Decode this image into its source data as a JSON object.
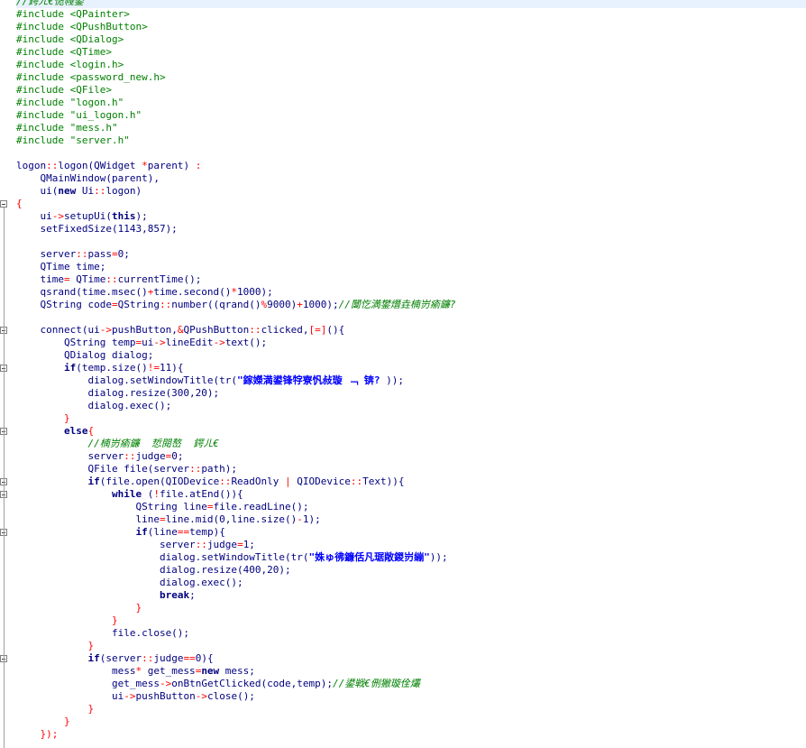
{
  "editor": {
    "lines": [
      [
        {
          "t": "//",
          "c": "cm"
        },
        {
          "t": "鍔ㄦ€佹帴鍙",
          "c": "cm"
        }
      ],
      [
        {
          "t": "#include <QPainter>",
          "c": "pp"
        }
      ],
      [
        {
          "t": "#include <QPushButton>",
          "c": "pp"
        }
      ],
      [
        {
          "t": "#include <QDialog>",
          "c": "pp"
        }
      ],
      [
        {
          "t": "#include <QTime>",
          "c": "pp"
        }
      ],
      [
        {
          "t": "#include <login.h>",
          "c": "pp"
        }
      ],
      [
        {
          "t": "#include <password_new.h>",
          "c": "pp"
        }
      ],
      [
        {
          "t": "#include <QFile>",
          "c": "pp"
        }
      ],
      [
        {
          "t": "#include \"logon.h\"",
          "c": "pp"
        }
      ],
      [
        {
          "t": "#include \"ui_logon.h\"",
          "c": "pp"
        }
      ],
      [
        {
          "t": "#include \"mess.h\"",
          "c": "pp"
        }
      ],
      [
        {
          "t": "#include \"server.h\"",
          "c": "pp"
        }
      ],
      [
        {
          "t": "",
          "c": "nm"
        }
      ],
      [
        {
          "t": "logon",
          "c": "nm"
        },
        {
          "t": "::",
          "c": "op"
        },
        {
          "t": "logon(QWidget ",
          "c": "nm"
        },
        {
          "t": "*",
          "c": "op"
        },
        {
          "t": "parent) ",
          "c": "nm"
        },
        {
          "t": ":",
          "c": "op"
        }
      ],
      [
        {
          "t": "    QMainWindow(parent),",
          "c": "nm"
        }
      ],
      [
        {
          "t": "    ui(",
          "c": "nm"
        },
        {
          "t": "new",
          "c": "kw"
        },
        {
          "t": " Ui",
          "c": "nm"
        },
        {
          "t": "::",
          "c": "op"
        },
        {
          "t": "logon)",
          "c": "nm"
        }
      ],
      [
        {
          "t": "{",
          "c": "op"
        }
      ],
      [
        {
          "t": "    ui",
          "c": "nm"
        },
        {
          "t": "->",
          "c": "op"
        },
        {
          "t": "setupUi(",
          "c": "nm"
        },
        {
          "t": "this",
          "c": "kw"
        },
        {
          "t": ");",
          "c": "nm"
        }
      ],
      [
        {
          "t": "    setFixedSize(1143,857);",
          "c": "nm"
        }
      ],
      [
        {
          "t": "",
          "c": "nm"
        }
      ],
      [
        {
          "t": "    server",
          "c": "nm"
        },
        {
          "t": "::",
          "c": "op"
        },
        {
          "t": "pass",
          "c": "nm"
        },
        {
          "t": "=",
          "c": "op"
        },
        {
          "t": "0;",
          "c": "nm"
        }
      ],
      [
        {
          "t": "    QTime time;",
          "c": "nm"
        }
      ],
      [
        {
          "t": "    time",
          "c": "nm"
        },
        {
          "t": "=",
          "c": "op"
        },
        {
          "t": " QTime",
          "c": "nm"
        },
        {
          "t": "::",
          "c": "op"
        },
        {
          "t": "currentTime();",
          "c": "nm"
        }
      ],
      [
        {
          "t": "    qsrand(time.msec()",
          "c": "nm"
        },
        {
          "t": "+",
          "c": "op"
        },
        {
          "t": "time.second()",
          "c": "nm"
        },
        {
          "t": "*",
          "c": "op"
        },
        {
          "t": "1000);",
          "c": "nm"
        }
      ],
      [
        {
          "t": "    QString code",
          "c": "nm"
        },
        {
          "t": "=",
          "c": "op"
        },
        {
          "t": "QString",
          "c": "nm"
        },
        {
          "t": "::",
          "c": "op"
        },
        {
          "t": "number((qrand()",
          "c": "nm"
        },
        {
          "t": "%",
          "c": "op"
        },
        {
          "t": "9000)",
          "c": "nm"
        },
        {
          "t": "+",
          "c": "op"
        },
        {
          "t": "1000);",
          "c": "nm"
        },
        {
          "t": "//闅忔満鐢熸垚楠岃瘉鐮?",
          "c": "cm"
        }
      ],
      [
        {
          "t": "",
          "c": "nm"
        }
      ],
      [
        {
          "t": "    connect(ui",
          "c": "nm"
        },
        {
          "t": "->",
          "c": "op"
        },
        {
          "t": "pushButton,",
          "c": "nm"
        },
        {
          "t": "&",
          "c": "op"
        },
        {
          "t": "QPushButton",
          "c": "nm"
        },
        {
          "t": "::",
          "c": "op"
        },
        {
          "t": "clicked,",
          "c": "nm"
        },
        {
          "t": "[=]",
          "c": "op"
        },
        {
          "t": "(){",
          "c": "nm"
        }
      ],
      [
        {
          "t": "        QString temp",
          "c": "nm"
        },
        {
          "t": "=",
          "c": "op"
        },
        {
          "t": "ui",
          "c": "nm"
        },
        {
          "t": "->",
          "c": "op"
        },
        {
          "t": "lineEdit",
          "c": "nm"
        },
        {
          "t": "->",
          "c": "op"
        },
        {
          "t": "text();",
          "c": "nm"
        }
      ],
      [
        {
          "t": "        QDialog dialog;",
          "c": "nm"
        }
      ],
      [
        {
          "t": "        ",
          "c": "nm"
        },
        {
          "t": "if",
          "c": "kw"
        },
        {
          "t": "(temp.size()",
          "c": "nm"
        },
        {
          "t": "!=",
          "c": "op"
        },
        {
          "t": "11){",
          "c": "nm"
        }
      ],
      [
        {
          "t": "            dialog.setWindowTitle(tr(",
          "c": "nm"
        },
        {
          "t": "\"鎵嬫満鍙锋牸寮忛敊璇 ﹁ 锛? ",
          "c": "qstr"
        },
        {
          "t": "));",
          "c": "nm"
        }
      ],
      [
        {
          "t": "            dialog.resize(300,20);",
          "c": "nm"
        }
      ],
      [
        {
          "t": "            dialog.exec();",
          "c": "nm"
        }
      ],
      [
        {
          "t": "        }",
          "c": "op"
        }
      ],
      [
        {
          "t": "        ",
          "c": "nm"
        },
        {
          "t": "else",
          "c": "kw"
        },
        {
          "t": "{",
          "c": "op"
        }
      ],
      [
        {
          "t": "            ",
          "c": "nm"
        },
        {
          "t": "//楠岃瘉鐮  悊閱嶅  鍔ㄦ€",
          "c": "cm"
        }
      ],
      [
        {
          "t": "            server",
          "c": "nm"
        },
        {
          "t": "::",
          "c": "op"
        },
        {
          "t": "judge",
          "c": "nm"
        },
        {
          "t": "=",
          "c": "op"
        },
        {
          "t": "0;",
          "c": "nm"
        }
      ],
      [
        {
          "t": "            QFile file(server",
          "c": "nm"
        },
        {
          "t": "::",
          "c": "op"
        },
        {
          "t": "path);",
          "c": "nm"
        }
      ],
      [
        {
          "t": "            ",
          "c": "nm"
        },
        {
          "t": "if",
          "c": "kw"
        },
        {
          "t": "(file.open(QIODevice",
          "c": "nm"
        },
        {
          "t": "::",
          "c": "op"
        },
        {
          "t": "ReadOnly ",
          "c": "nm"
        },
        {
          "t": "|",
          "c": "op"
        },
        {
          "t": " QIODevice",
          "c": "nm"
        },
        {
          "t": "::",
          "c": "op"
        },
        {
          "t": "Text)){",
          "c": "nm"
        }
      ],
      [
        {
          "t": "                ",
          "c": "nm"
        },
        {
          "t": "while",
          "c": "kw"
        },
        {
          "t": " (",
          "c": "nm"
        },
        {
          "t": "!",
          "c": "op"
        },
        {
          "t": "file.atEnd()){",
          "c": "nm"
        }
      ],
      [
        {
          "t": "                    QString line",
          "c": "nm"
        },
        {
          "t": "=",
          "c": "op"
        },
        {
          "t": "file.readLine();",
          "c": "nm"
        }
      ],
      [
        {
          "t": "                    line",
          "c": "nm"
        },
        {
          "t": "=",
          "c": "op"
        },
        {
          "t": "line.mid(0,line.size()",
          "c": "nm"
        },
        {
          "t": "-",
          "c": "op"
        },
        {
          "t": "1);",
          "c": "nm"
        }
      ],
      [
        {
          "t": "                    ",
          "c": "nm"
        },
        {
          "t": "if",
          "c": "kw"
        },
        {
          "t": "(line",
          "c": "nm"
        },
        {
          "t": "==",
          "c": "op"
        },
        {
          "t": "temp){",
          "c": "nm"
        }
      ],
      [
        {
          "t": "                        server",
          "c": "nm"
        },
        {
          "t": "::",
          "c": "op"
        },
        {
          "t": "judge",
          "c": "nm"
        },
        {
          "t": "=",
          "c": "op"
        },
        {
          "t": "1;",
          "c": "nm"
        }
      ],
      [
        {
          "t": "                        dialog.setWindowTitle(tr(",
          "c": "nm"
        },
        {
          "t": "\"姝ゅ彿鐮佸凡琚敞鍐岃繃\"",
          "c": "qstr"
        },
        {
          "t": "));",
          "c": "nm"
        }
      ],
      [
        {
          "t": "                        dialog.resize(400,20);",
          "c": "nm"
        }
      ],
      [
        {
          "t": "                        dialog.exec();",
          "c": "nm"
        }
      ],
      [
        {
          "t": "                        ",
          "c": "nm"
        },
        {
          "t": "break",
          "c": "kw"
        },
        {
          "t": ";",
          "c": "nm"
        }
      ],
      [
        {
          "t": "                    }",
          "c": "op"
        }
      ],
      [
        {
          "t": "                }",
          "c": "op"
        }
      ],
      [
        {
          "t": "                file.close();",
          "c": "nm"
        }
      ],
      [
        {
          "t": "            }",
          "c": "op"
        }
      ],
      [
        {
          "t": "            ",
          "c": "nm"
        },
        {
          "t": "if",
          "c": "kw"
        },
        {
          "t": "(server",
          "c": "nm"
        },
        {
          "t": "::",
          "c": "op"
        },
        {
          "t": "judge",
          "c": "nm"
        },
        {
          "t": "==",
          "c": "op"
        },
        {
          "t": "0){",
          "c": "nm"
        }
      ],
      [
        {
          "t": "                mess",
          "c": "nm"
        },
        {
          "t": "*",
          "c": "op"
        },
        {
          "t": " get_mess",
          "c": "nm"
        },
        {
          "t": "=",
          "c": "op"
        },
        {
          "t": "new",
          "c": "kw"
        },
        {
          "t": " mess;",
          "c": "nm"
        }
      ],
      [
        {
          "t": "                get_mess",
          "c": "nm"
        },
        {
          "t": "->",
          "c": "op"
        },
        {
          "t": "onBtnGetClicked(code,temp);",
          "c": "nm"
        },
        {
          "t": "//鍙戦€侀獙璇佺爜",
          "c": "cm"
        }
      ],
      [
        {
          "t": "                ui",
          "c": "nm"
        },
        {
          "t": "->",
          "c": "op"
        },
        {
          "t": "pushButton",
          "c": "nm"
        },
        {
          "t": "->",
          "c": "op"
        },
        {
          "t": "close();",
          "c": "nm"
        }
      ],
      [
        {
          "t": "            }",
          "c": "op"
        }
      ],
      [
        {
          "t": "        }",
          "c": "op"
        }
      ],
      [
        {
          "t": "    });",
          "c": "op"
        }
      ]
    ],
    "folds": [
      16,
      26,
      29,
      34,
      38,
      39,
      42,
      52
    ]
  }
}
